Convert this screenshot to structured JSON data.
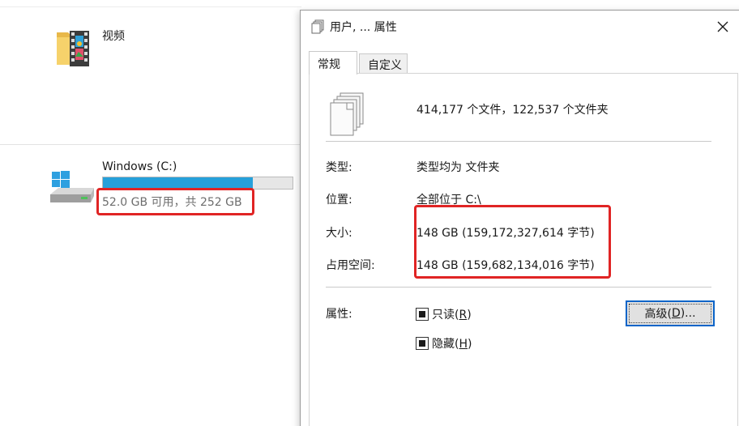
{
  "explorer": {
    "folder": {
      "label": "视频",
      "icon": "video-folder-icon"
    },
    "drive": {
      "name": "Windows (C:)",
      "space_text": "52.0 GB 可用，共 252 GB",
      "used_fraction": 0.79,
      "bar_color": "#26a0da",
      "icon": "windows-drive-icon"
    }
  },
  "dialog": {
    "title": "用户, ... 属性",
    "close_icon": "close-icon",
    "tabs": [
      {
        "label": "常规",
        "active": true
      },
      {
        "label": "自定义",
        "active": false
      }
    ],
    "summary": "414,177 个文件，122,537 个文件夹",
    "rows": {
      "type": {
        "label": "类型:",
        "value": "类型均为 文件夹"
      },
      "location": {
        "label": "位置:",
        "value": "全部位于 C:\\"
      },
      "size": {
        "label": "大小:",
        "value": "148 GB (159,172,327,614 字节)"
      },
      "size_on_disk": {
        "label": "占用空间:",
        "value": "148 GB (159,682,134,016 字节)"
      }
    },
    "attributes": {
      "label": "属性:",
      "readonly": {
        "label_main": "只读(",
        "label_key": "R",
        "label_end": ")",
        "state": "indeterminate"
      },
      "hidden": {
        "label_main": "隐藏(",
        "label_key": "H",
        "label_end": ")",
        "state": "indeterminate"
      },
      "advanced_button": {
        "label_main": "高级(",
        "label_key": "D",
        "label_end": ")..."
      }
    }
  },
  "colors": {
    "highlight_box": "#e02424",
    "focus_border": "#0a64c8"
  }
}
